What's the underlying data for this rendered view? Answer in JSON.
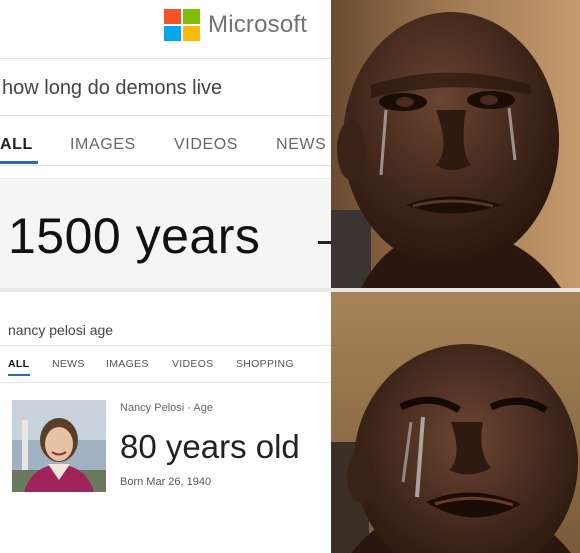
{
  "colors": {
    "ms_red": "#f35325",
    "ms_green": "#81bc06",
    "ms_blue": "#05a6f0",
    "ms_yellow": "#ffba08",
    "active_tab_underline": "#2b6cb0"
  },
  "top_panel": {
    "brand": "Microsoft",
    "query": "how long do demons live",
    "tabs": [
      "ALL",
      "IMAGES",
      "VIDEOS",
      "NEWS"
    ],
    "active_tab": "ALL",
    "answer": "1500 years"
  },
  "bottom_panel": {
    "query": "nancy pelosi age",
    "tabs": [
      "ALL",
      "NEWS",
      "IMAGES",
      "VIDEOS",
      "SHOPPING"
    ],
    "active_tab": "ALL",
    "result_label": "Nancy Pelosi · Age",
    "answer": "80 years old",
    "born": "Born Mar 26, 1940"
  }
}
